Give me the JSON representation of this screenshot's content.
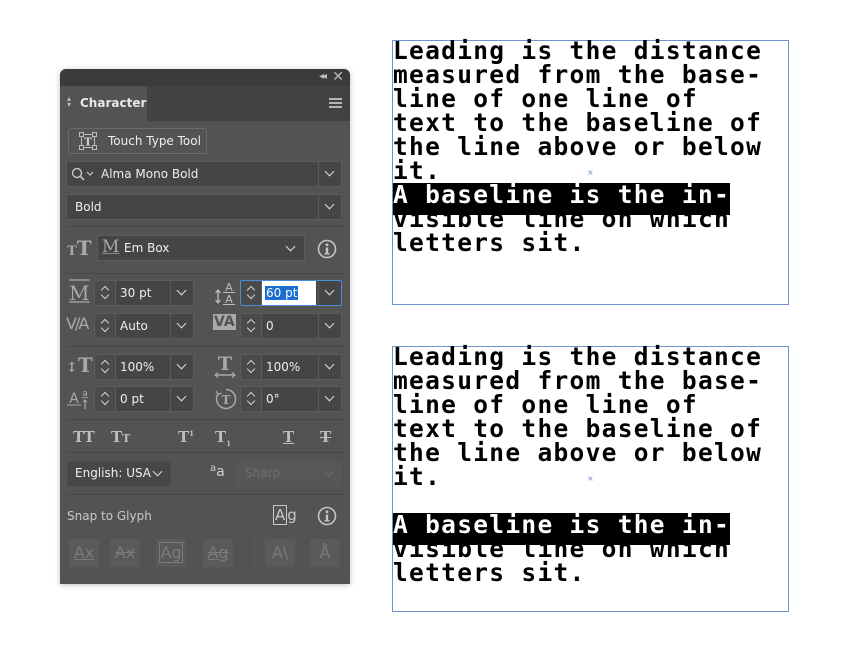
{
  "panel": {
    "title": "Character",
    "touch_type_button": "Touch Type Tool",
    "font_family": "Alma Mono Bold",
    "font_style": "Bold",
    "alignment_option": "Em Box",
    "font_size": "30 pt",
    "leading": "60 pt",
    "kerning": "Auto",
    "tracking": "0",
    "vertical_scale": "100%",
    "horizontal_scale": "100%",
    "baseline_shift": "0 pt",
    "character_rotation": "0°",
    "language": "English: USA",
    "anti_aliasing": "Sharp",
    "snap_to_glyph_label": "Snap to Glyph",
    "type_buttons": [
      "TT",
      "Tт",
      "T¹",
      "T₁",
      "T",
      "T"
    ],
    "snap_buttons": [
      "Ax",
      "Ax",
      "Ag",
      "Ag",
      "A\\",
      "Å"
    ]
  },
  "frames": [
    {
      "lines": [
        {
          "text": "Leading is the distance",
          "selected": false
        },
        {
          "text": "measured from the base-",
          "selected": false
        },
        {
          "text": "line of one line of",
          "selected": false
        },
        {
          "text": "text to the baseline of",
          "selected": false
        },
        {
          "text": "the line above or below",
          "selected": false
        },
        {
          "text": "it.",
          "selected": false
        },
        {
          "text": "A baseline is the in-",
          "selected": true
        },
        {
          "text": "visible line on which",
          "selected": false
        },
        {
          "text": "letters sit.",
          "selected": false
        }
      ]
    },
    {
      "lines": [
        {
          "text": "Leading is the distance",
          "selected": false
        },
        {
          "text": "measured from the base-",
          "selected": false
        },
        {
          "text": "line of one line of",
          "selected": false
        },
        {
          "text": "text to the baseline of",
          "selected": false
        },
        {
          "text": "the line above or below",
          "selected": false
        },
        {
          "text": "it.",
          "selected": false
        },
        {
          "text": "A baseline is the in-",
          "selected": true
        },
        {
          "text": "visible line on which",
          "selected": false
        },
        {
          "text": "letters sit.",
          "selected": false
        }
      ]
    }
  ],
  "colors": {
    "panel_bg": "#535353",
    "selection_blue": "#1a6fd0",
    "frame_border": "#6d93cc"
  }
}
